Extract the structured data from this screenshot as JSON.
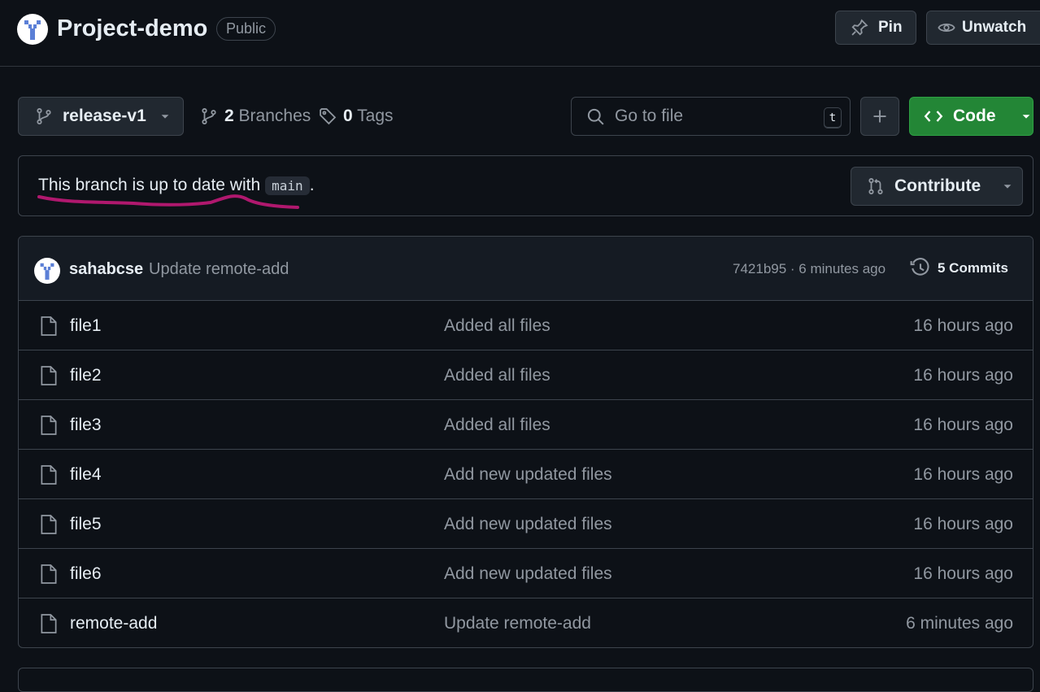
{
  "repo": {
    "name": "Project-demo",
    "visibility": "Public",
    "pin_label": "Pin",
    "unwatch_label": "Unwatch"
  },
  "toolbar": {
    "branch_name": "release-v1",
    "branches_count": "2",
    "branches_label": "Branches",
    "tags_count": "0",
    "tags_label": "Tags",
    "goto_placeholder": "Go to file",
    "goto_shortcut": "t",
    "code_label": "Code"
  },
  "notice": {
    "text": "This branch is up to date with",
    "branch": "main",
    "suffix": ".",
    "contribute_label": "Contribute",
    "annotation_color": "#b0186e"
  },
  "latest_commit": {
    "author": "sahabcse",
    "message": "Update remote-add",
    "meta": "7421b95 · 6 minutes ago",
    "commits_label": "5 Commits"
  },
  "files": [
    {
      "name": "file1",
      "message": "Added all files",
      "time": "16 hours ago"
    },
    {
      "name": "file2",
      "message": "Added all files",
      "time": "16 hours ago"
    },
    {
      "name": "file3",
      "message": "Added all files",
      "time": "16 hours ago"
    },
    {
      "name": "file4",
      "message": "Add new updated files",
      "time": "16 hours ago"
    },
    {
      "name": "file5",
      "message": "Add new updated files",
      "time": "16 hours ago"
    },
    {
      "name": "file6",
      "message": "Add new updated files",
      "time": "16 hours ago"
    },
    {
      "name": "remote-add",
      "message": "Update remote-add",
      "time": "6 minutes ago"
    }
  ],
  "colors": {
    "background": "#0d1117",
    "code_button": "#238636",
    "border": "#3d444d",
    "muted_text": "#9198a1"
  }
}
